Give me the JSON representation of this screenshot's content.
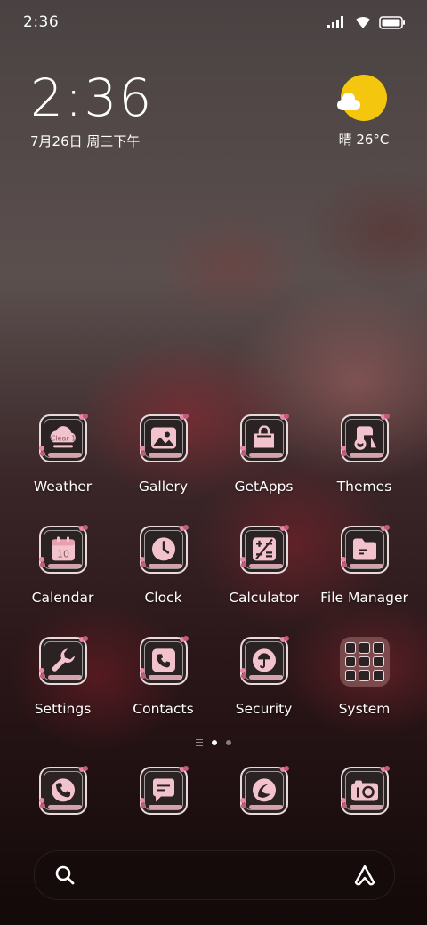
{
  "status_bar": {
    "time": "2:36",
    "icons": [
      "signal-icon",
      "wifi-icon",
      "battery-icon"
    ]
  },
  "clock_widget": {
    "time": "2:36",
    "date": "7月26日 周三下午"
  },
  "weather_widget": {
    "text": "晴 26°C",
    "icon": "sunny-cloud-icon"
  },
  "apps": [
    {
      "label": "Weather",
      "icon": "weather-icon",
      "glyph_text": "Clear 1"
    },
    {
      "label": "Gallery",
      "icon": "gallery-icon"
    },
    {
      "label": "GetApps",
      "icon": "shopping-bag-icon"
    },
    {
      "label": "Themes",
      "icon": "themes-icon"
    },
    {
      "label": "Calendar",
      "icon": "calendar-icon",
      "glyph_text": "10"
    },
    {
      "label": "Clock",
      "icon": "clock-icon"
    },
    {
      "label": "Calculator",
      "icon": "calculator-icon"
    },
    {
      "label": "File Manager",
      "icon": "folder-icon"
    },
    {
      "label": "Settings",
      "icon": "wrench-icon"
    },
    {
      "label": "Contacts",
      "icon": "contacts-icon"
    },
    {
      "label": "Security",
      "icon": "shield-icon"
    },
    {
      "label": "System",
      "icon": "folder-grid-icon"
    }
  ],
  "page_indicator": {
    "pages": 2,
    "active": 0
  },
  "dock": [
    {
      "icon": "phone-icon"
    },
    {
      "icon": "message-icon"
    },
    {
      "icon": "browser-icon"
    },
    {
      "icon": "camera-icon"
    }
  ],
  "search_bar": {
    "left_icon": "search-icon",
    "right_icon": "assistant-icon"
  },
  "colors": {
    "icon_glyph": "#f3c3cd",
    "icon_bg": "#2b2223",
    "weather_sun": "#f4c60e"
  }
}
